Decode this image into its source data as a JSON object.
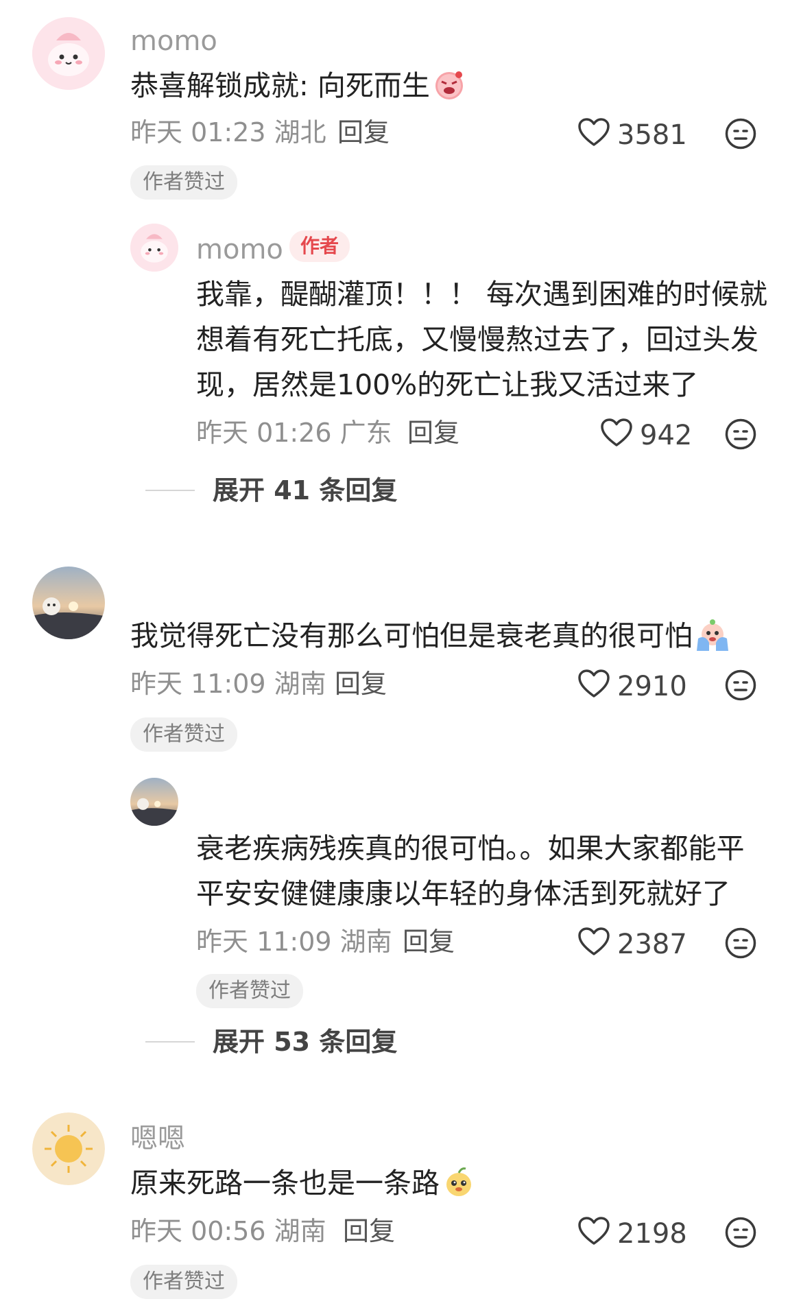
{
  "comments": [
    {
      "user": "momo",
      "text": "恭喜解锁成就: 向死而生",
      "emoji": "angry-pig-emoji",
      "time": "昨天 01:23 湖北",
      "reply_label": "回复",
      "likes": "3581",
      "badge": "作者赞过",
      "replies": [
        {
          "user": "momo",
          "author_tag": "作者",
          "lines": [
            "我靠，醍醐灌顶！！！ 每次遇到困难的时候就",
            "想着有死亡托底，又慢慢熬过去了，回过头发",
            "现，居然是100%的死亡让我又活过来了"
          ],
          "time": "昨天 01:26 广东",
          "reply_label": "回复",
          "likes": "942"
        }
      ],
      "expand": "展开 41 条回复"
    },
    {
      "user": "",
      "text": "我觉得死亡没有那么可怕但是衰老真的很可怕",
      "emoji": "crying-emoji",
      "time": "昨天 11:09 湖南",
      "reply_label": "回复",
      "likes": "2910",
      "badge": "作者赞过",
      "replies": [
        {
          "user": "",
          "lines": [
            "衰老疾病残疾真的很可怕。。如果大家都能平",
            "平安安健健康康以年轻的身体活到死就好了"
          ],
          "time": "昨天 11:09 湖南",
          "reply_label": "回复",
          "likes": "2387",
          "badge": "作者赞过"
        }
      ],
      "expand": "展开 53 条回复"
    },
    {
      "user": "嗯嗯",
      "text": "原来死路一条也是一条路",
      "emoji": "happy-pear-emoji",
      "time": "昨天 00:56 湖南",
      "reply_label": "回复",
      "likes": "2198",
      "badge": "作者赞过"
    }
  ],
  "colors": {
    "accent": "#e5484d",
    "text": "#222222",
    "meta": "#8f8f8f",
    "badge_bg": "#f1f1f1"
  }
}
